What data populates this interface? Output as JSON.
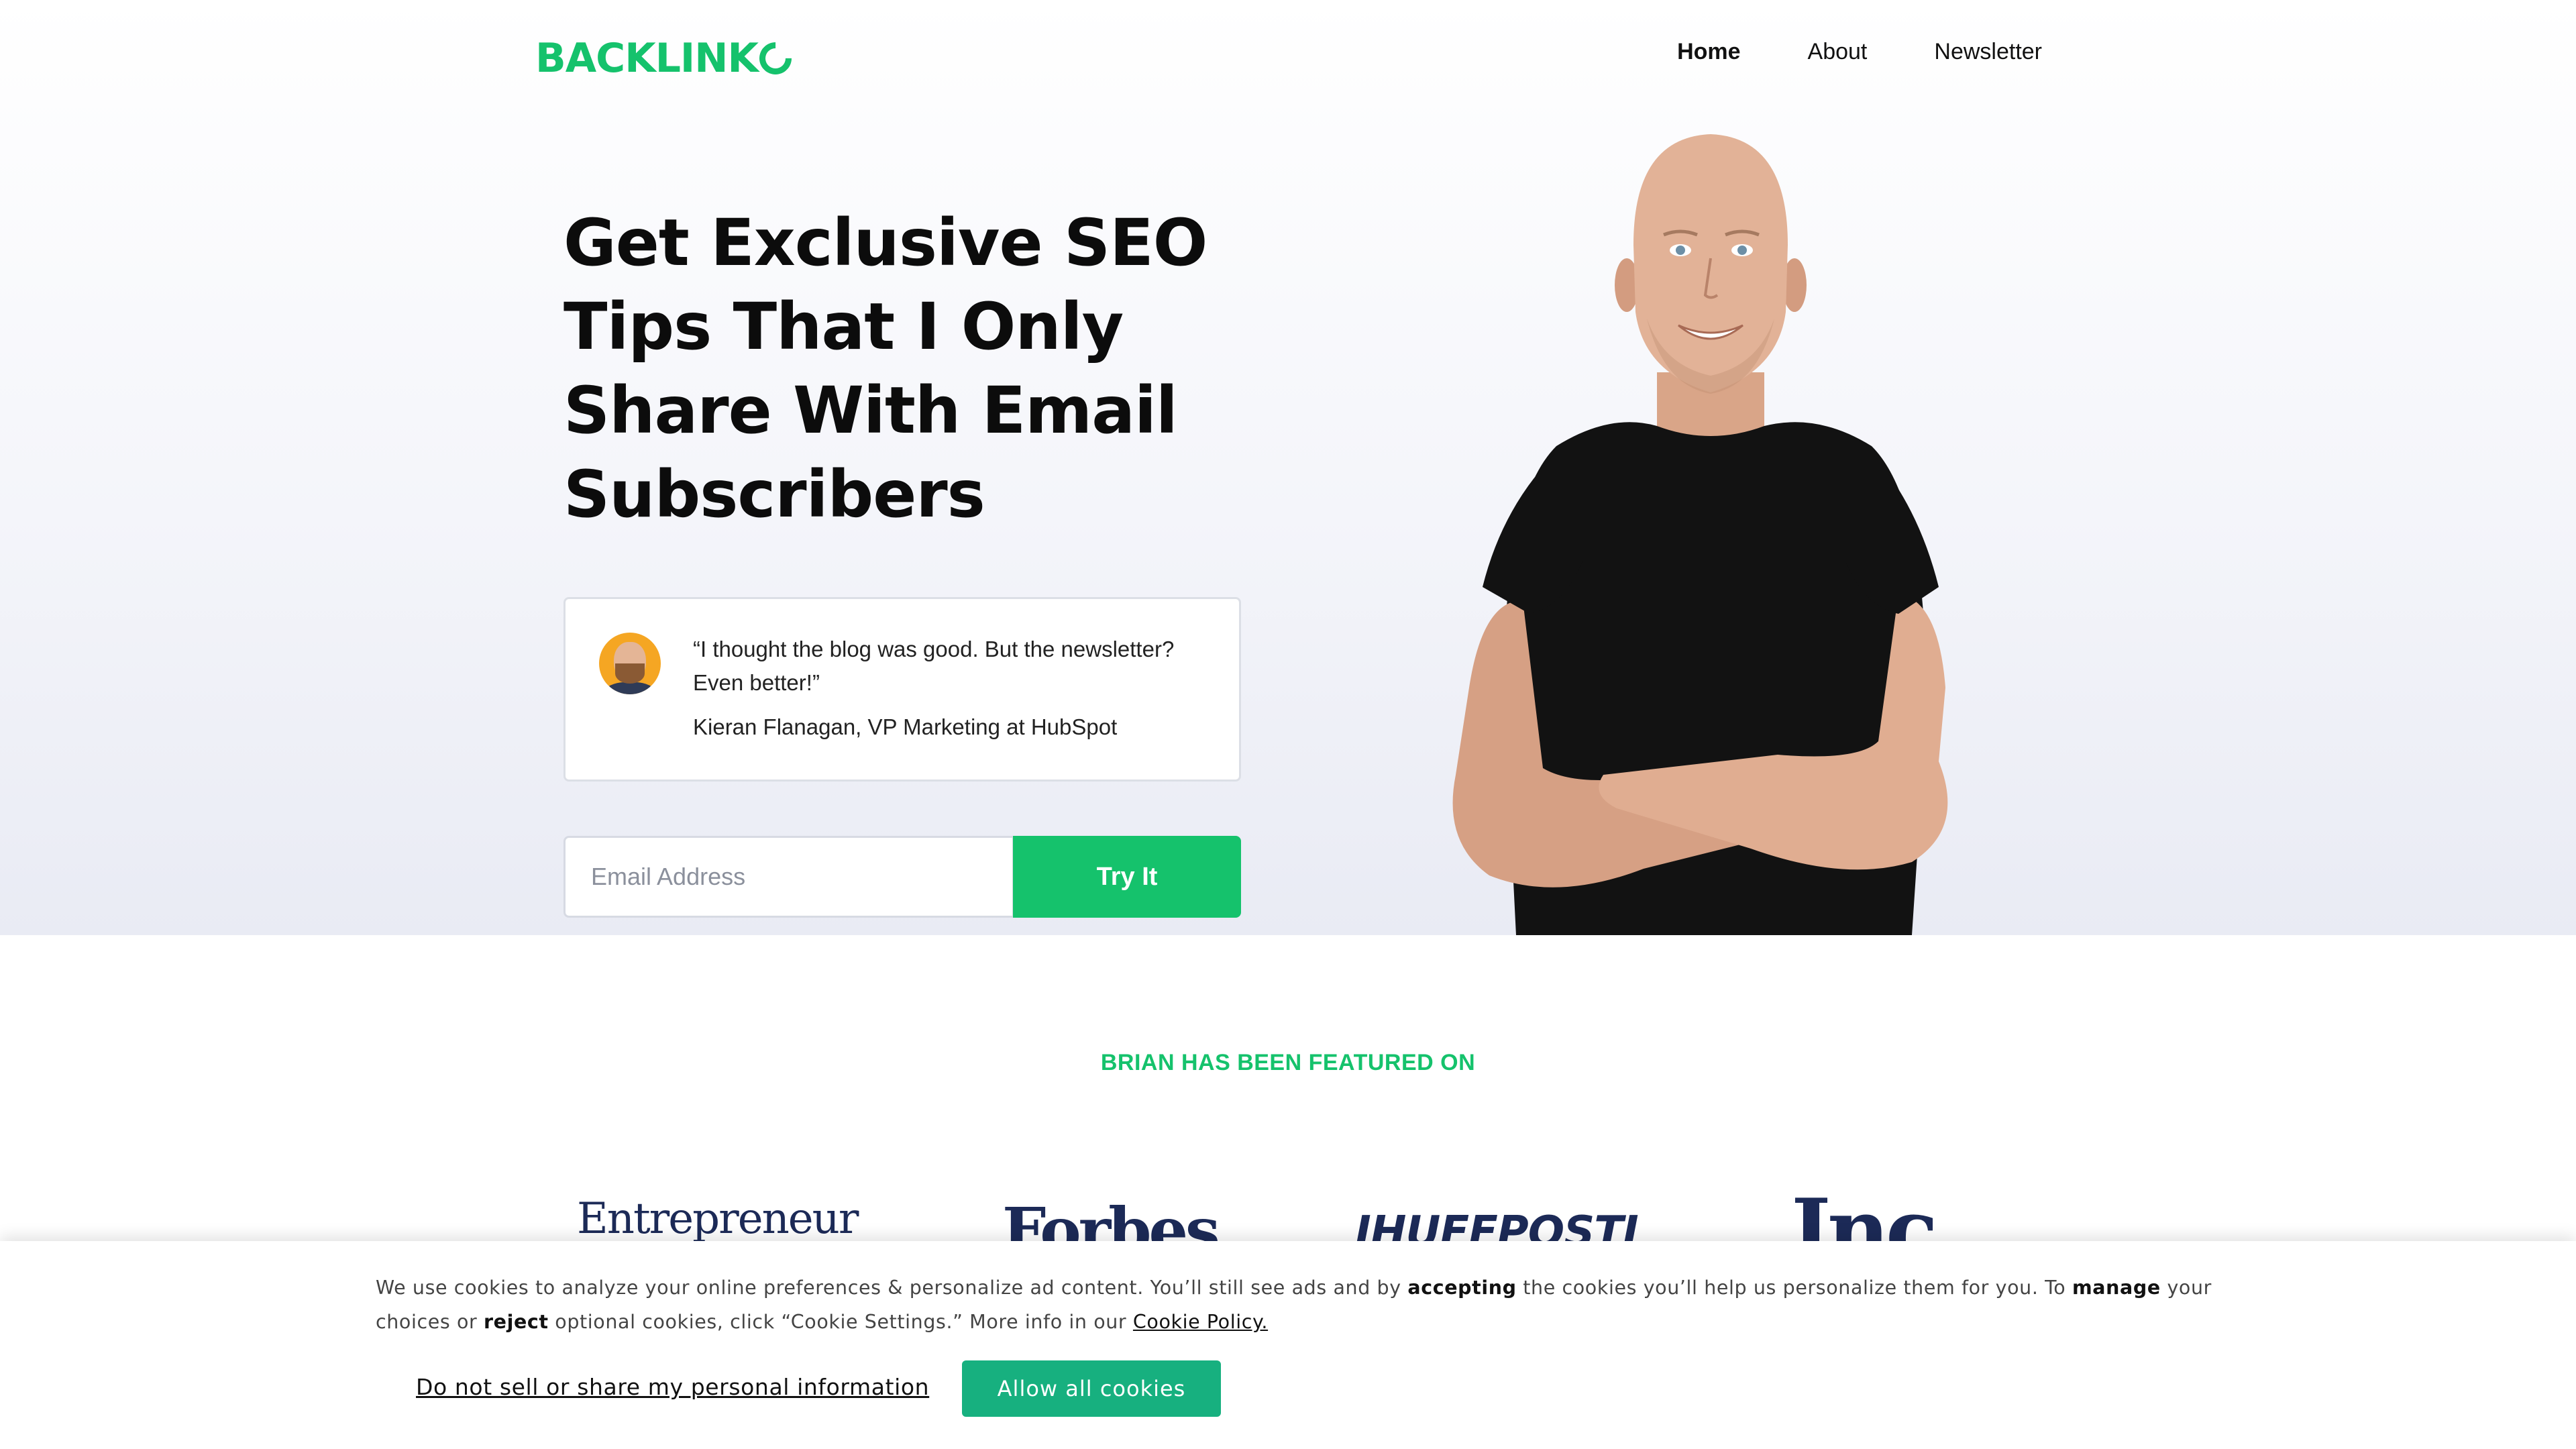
{
  "header": {
    "logo_text": "BACKLINK",
    "nav": [
      {
        "label": "Home",
        "active": true
      },
      {
        "label": "About",
        "active": false
      },
      {
        "label": "Newsletter",
        "active": false
      }
    ]
  },
  "hero": {
    "headline": "Get Exclusive SEO Tips That I Only Share With Email Subscribers",
    "testimonial": {
      "quote": "“I thought the blog was good. But the newsletter? Even better!”",
      "author": "Kieran Flanagan, VP Marketing at HubSpot"
    },
    "signup": {
      "email_placeholder": "Email Address",
      "button_label": "Try It"
    }
  },
  "featured": {
    "label": "BRIAN HAS BEEN FEATURED ON",
    "logos": [
      "Entrepreneur",
      "Forbes",
      "IHUFFPOSTI",
      "Inc."
    ]
  },
  "cookie_banner": {
    "text_1": "We use cookies to analyze your online preferences & personalize ad content. You’ll still see ads and by ",
    "bold_1": "accepting",
    "text_2": " the cookies you’ll help us personalize them for you. To ",
    "bold_2": "manage",
    "text_3": " your choices or ",
    "bold_3": "reject",
    "text_4": " optional cookies, click “Cookie Settings.” More info in our ",
    "policy_link": "Cookie Policy.",
    "do_not_sell_label": "Do not sell or share my personal information",
    "allow_label": "Allow all cookies"
  },
  "colors": {
    "brand_green": "#15c26c",
    "cookie_button": "#17b07f",
    "logo_navy": "#1c2a57"
  }
}
